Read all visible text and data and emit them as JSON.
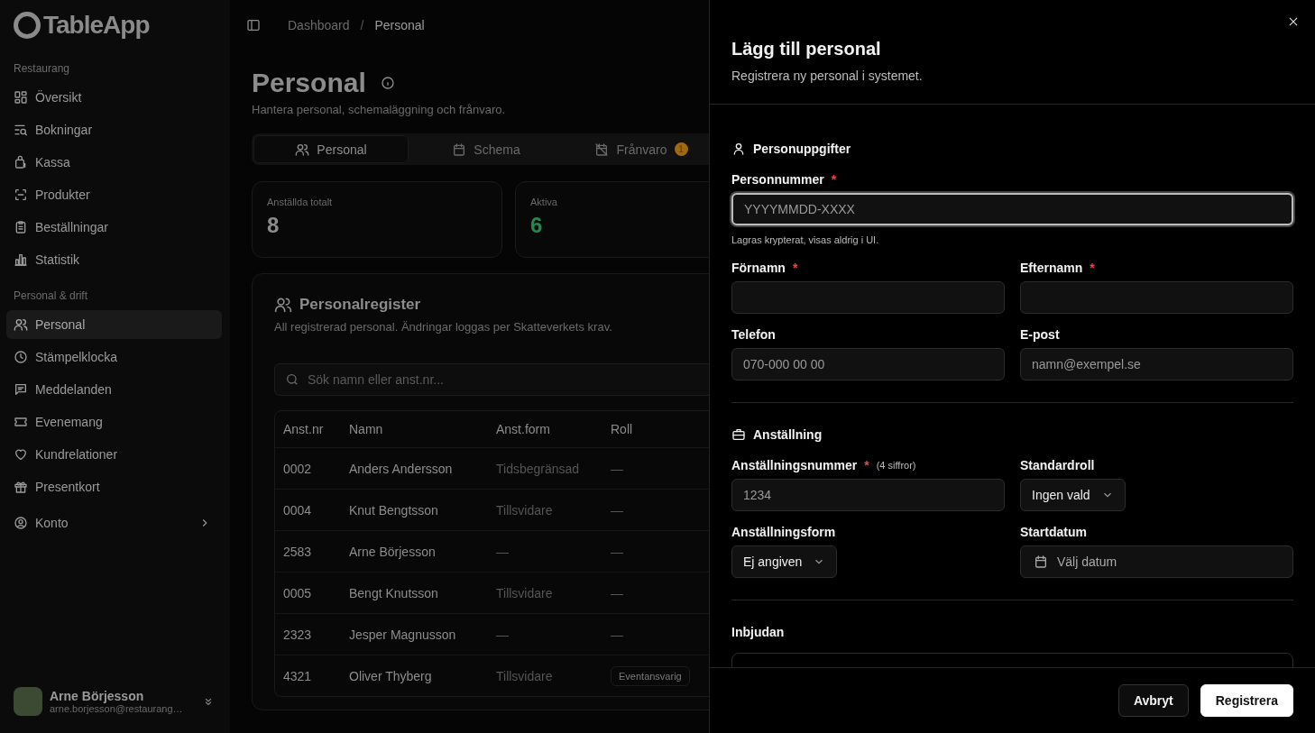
{
  "sidebar": {
    "logo": "TableApp",
    "groups": [
      {
        "label": "Restaurang",
        "items": [
          {
            "label": "Översikt",
            "selected": false
          },
          {
            "label": "Bokningar",
            "selected": false
          },
          {
            "label": "Kassa",
            "selected": false
          },
          {
            "label": "Produkter",
            "selected": false
          },
          {
            "label": "Beställningar",
            "selected": false
          },
          {
            "label": "Statistik",
            "selected": false
          }
        ]
      },
      {
        "label": "Personal & drift",
        "items": [
          {
            "label": "Personal",
            "selected": true
          },
          {
            "label": "Stämpelklocka",
            "selected": false
          },
          {
            "label": "Meddelanden",
            "selected": false
          },
          {
            "label": "Evenemang",
            "selected": false
          },
          {
            "label": "Kundrelationer",
            "selected": false
          },
          {
            "label": "Presentkort",
            "selected": false
          }
        ]
      }
    ],
    "account_link": {
      "label": "Konto",
      "expanded": false
    },
    "user": {
      "name": "Arne Börjesson",
      "email": "arne.borjesson@restaurang…"
    }
  },
  "breadcrumb": {
    "items": [
      "Dashboard",
      "Personal"
    ],
    "separator": "/"
  },
  "page": {
    "title": "Personal",
    "subtitle": "Hantera personal, schemaläggning och frånvaro."
  },
  "tabs": [
    {
      "label": "Personal",
      "selected": true
    },
    {
      "label": "Schema",
      "selected": false
    },
    {
      "label": "Frånvaro",
      "selected": false,
      "badge": "1"
    }
  ],
  "stats": [
    {
      "label": "Anställda totalt",
      "value": "8",
      "color": "#8c8c8c"
    },
    {
      "label": "Aktiva",
      "value": "6",
      "color": "#1f8a4c"
    }
  ],
  "register": {
    "title": "Personalregister",
    "description": "All registrerad personal. Ändringar loggas per Skatteverkets krav.",
    "search": {
      "placeholder": "Sök namn eller anst.nr..."
    },
    "columns": [
      "Anst.nr",
      "Namn",
      "Anst.form",
      "Roll"
    ],
    "rows": [
      {
        "number": "0002",
        "name": "Anders Andersson",
        "form": "Tidsbegränsad",
        "role": "—"
      },
      {
        "number": "0004",
        "name": "Knut Bengtsson",
        "form": "Tillsvidare",
        "role": "—"
      },
      {
        "number": "2583",
        "name": "Arne Börjesson",
        "form": "—",
        "role": "—"
      },
      {
        "number": "0005",
        "name": "Bengt Knutsson",
        "form": "Tillsvidare",
        "role": "—"
      },
      {
        "number": "2323",
        "name": "Jesper Magnusson",
        "form": "—",
        "role": "—"
      },
      {
        "number": "4321",
        "name": "Oliver Thyberg",
        "form": "Tillsvidare",
        "role_badges": [
          "Eventansvarig"
        ]
      }
    ]
  },
  "drawer": {
    "title": "Lägg till personal",
    "subtitle": "Registrera ny personal i systemet.",
    "sections": [
      {
        "title": "Personuppgifter",
        "rows": [
          [
            {
              "kind": "text",
              "label": "Personnummer",
              "required_marker": "*",
              "placeholder": "YYYYMMDD-XXXX",
              "focused": true,
              "hint": "Lagras krypterat, visas aldrig i UI."
            }
          ],
          [
            {
              "kind": "text",
              "label": "Förnamn",
              "required_marker": "*",
              "focused": false
            },
            {
              "kind": "text",
              "label": "Efternamn",
              "required_marker": "*",
              "focused": false
            }
          ],
          [
            {
              "kind": "text",
              "label": "Telefon",
              "placeholder": "070-000 00 00",
              "focused": false
            },
            {
              "kind": "text",
              "label": "E-post",
              "placeholder": "namn@exempel.se",
              "focused": false
            }
          ]
        ]
      },
      {
        "title": "Anställning",
        "rows": [
          [
            {
              "kind": "text",
              "label": "Anställningsnummer",
              "required_marker": "*",
              "note": "(4 siffror)",
              "placeholder": "1234",
              "focused": false
            },
            {
              "kind": "select",
              "label": "Standardroll",
              "value": "Ingen vald"
            }
          ],
          [
            {
              "kind": "select",
              "label": "Anställningsform",
              "value": "Ej angiven"
            },
            {
              "kind": "date",
              "label": "Startdatum",
              "placeholder": "Välj datum"
            }
          ]
        ]
      },
      {
        "title": "Inbjudan"
      }
    ],
    "buttons": [
      {
        "kind": "secondary",
        "label": "Avbryt"
      },
      {
        "kind": "primary",
        "label": "Registrera"
      }
    ]
  }
}
